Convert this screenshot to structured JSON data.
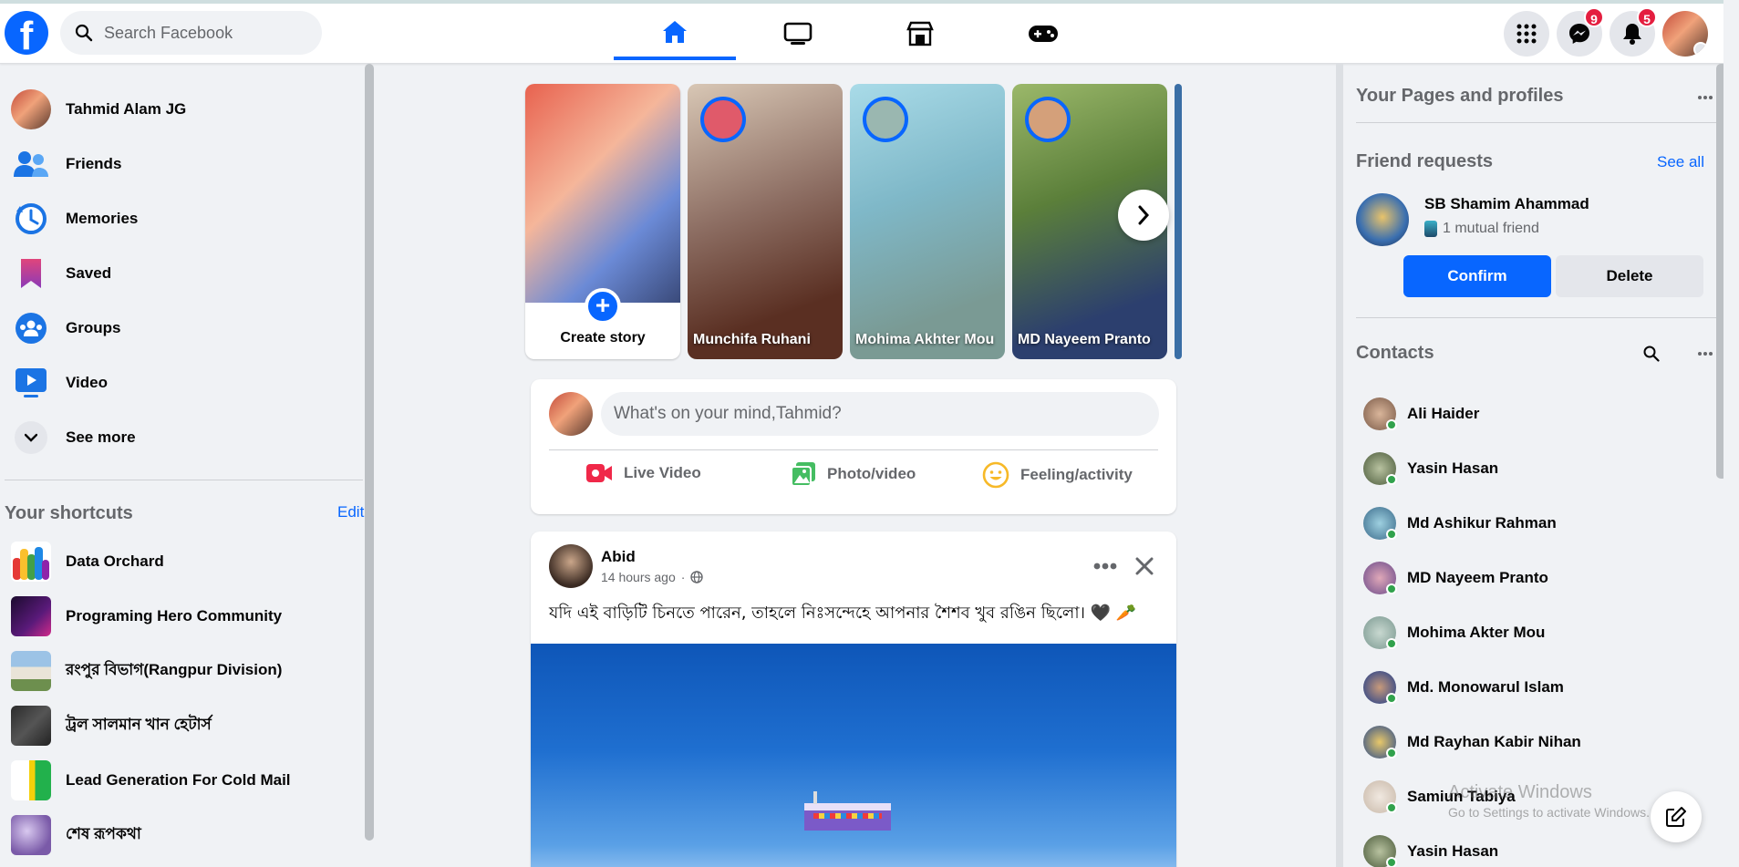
{
  "header": {
    "logo": "f",
    "search_placeholder": "Search Facebook",
    "nav_tabs": [
      {
        "icon": "home-icon",
        "active": true
      },
      {
        "icon": "watch-icon",
        "active": false
      },
      {
        "icon": "marketplace-icon",
        "active": false
      },
      {
        "icon": "gaming-icon",
        "active": false
      }
    ],
    "messenger_badge": "9",
    "notifications_badge": "5"
  },
  "sidebar": {
    "profile_name": "Tahmid Alam JG",
    "items": [
      {
        "label": "Friends",
        "icon": "friends-icon"
      },
      {
        "label": "Memories",
        "icon": "memories-icon"
      },
      {
        "label": "Saved",
        "icon": "saved-icon"
      },
      {
        "label": "Groups",
        "icon": "groups-icon"
      },
      {
        "label": "Video",
        "icon": "video-icon"
      },
      {
        "label": "See more",
        "icon": "chevron-down-icon"
      }
    ],
    "shortcuts_title": "Your shortcuts",
    "shortcuts_edit": "Edit",
    "shortcuts": [
      "Data Orchard",
      "Programing Hero Community",
      "রংপুর বিভাগ(Rangpur Division)",
      "ট্রল সালমান খান হেটার্স",
      "Lead Generation For Cold Mail",
      "শেষ রূপকথা"
    ]
  },
  "stories": {
    "create_label": "Create story",
    "items": [
      {
        "name": "Munchifa Ruhani",
        "color": "#8d6e63"
      },
      {
        "name": "Mohima Akhter Mou",
        "color": "#7fb8c8"
      },
      {
        "name": "MD Nayeem Pranto",
        "color": "#5b7f3a"
      }
    ]
  },
  "composer": {
    "placeholder": "What's on your mind,Tahmid?",
    "live_label": "Live Video",
    "photo_label": "Photo/video",
    "feeling_label": "Feeling/activity"
  },
  "post": {
    "author": "Abid",
    "time": "14 hours ago",
    "text": "যদি এই বাড়িটি চিনতে পারেন, তাহলে নিঃসন্দেহে আপনার শৈশব খুব রঙিন ছিলো। 🖤 🥕"
  },
  "right": {
    "pages_title": "Your Pages and profiles",
    "requests_title": "Friend requests",
    "see_all": "See all",
    "request_name": "SB Shamim Ahammad",
    "request_mutual": "1 mutual friend",
    "confirm": "Confirm",
    "delete": "Delete",
    "contacts_title": "Contacts",
    "contacts": [
      "Ali Haider",
      "Yasin Hasan",
      "Md Ashikur Rahman",
      "MD Nayeem Pranto",
      "Mohima Akter Mou",
      "Md. Monowarul Islam",
      "Md Rayhan Kabir Nihan",
      "Samiun Tabiya",
      "Yasin Hasan"
    ]
  },
  "overlay": {
    "activate_title": "Activate Windows",
    "activate_sub": "Go to Settings to activate Windows."
  },
  "colors": {
    "accent": "#0866ff",
    "background": "#f0f2f5",
    "badge": "#e41e3f",
    "online": "#31a24c"
  }
}
